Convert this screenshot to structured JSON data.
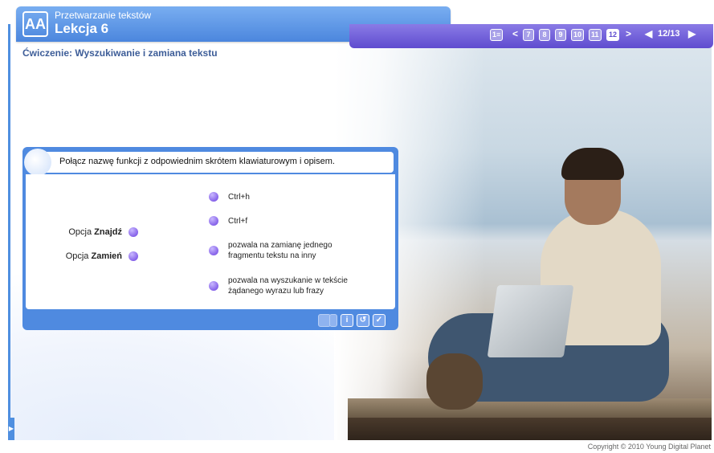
{
  "header": {
    "logo_text": "AA",
    "subject": "Przetwarzanie tekstów",
    "lesson": "Lekcja 6"
  },
  "nav": {
    "menu_label": "1≡",
    "prev": "<",
    "next": ">",
    "pages": [
      "7",
      "8",
      "9",
      "10",
      "11",
      "12"
    ],
    "current_page": "12",
    "counter": "12/13",
    "back_arrow": "◀",
    "forward_arrow": "▶"
  },
  "exercise_title": "Ćwiczenie: Wyszukiwanie i zamiana tekstu",
  "task": {
    "instruction": "Połącz nazwę funkcji z odpowiednim skrótem klawiaturowym i opisem.",
    "left_items": [
      {
        "prefix": "Opcja ",
        "name": "Znajdź"
      },
      {
        "prefix": "Opcja ",
        "name": "Zamień"
      }
    ],
    "right_items": [
      {
        "text": "Ctrl+h"
      },
      {
        "text": "Ctrl+f"
      },
      {
        "text": "pozwala na zamianę jednego fragmentu tekstu na inny"
      },
      {
        "text": "pozwala na wyszukanie w tekście żądanego wyrazu lub frazy"
      }
    ],
    "tools": [
      "hint-icon",
      "reset-icon",
      "check-icon"
    ]
  },
  "copyright": "Copyright © 2010 Young Digital Planet",
  "colors": {
    "accent": "#4f8ae0",
    "nav_bar": "#6f5ddb",
    "dot": "#6a3fe0"
  }
}
